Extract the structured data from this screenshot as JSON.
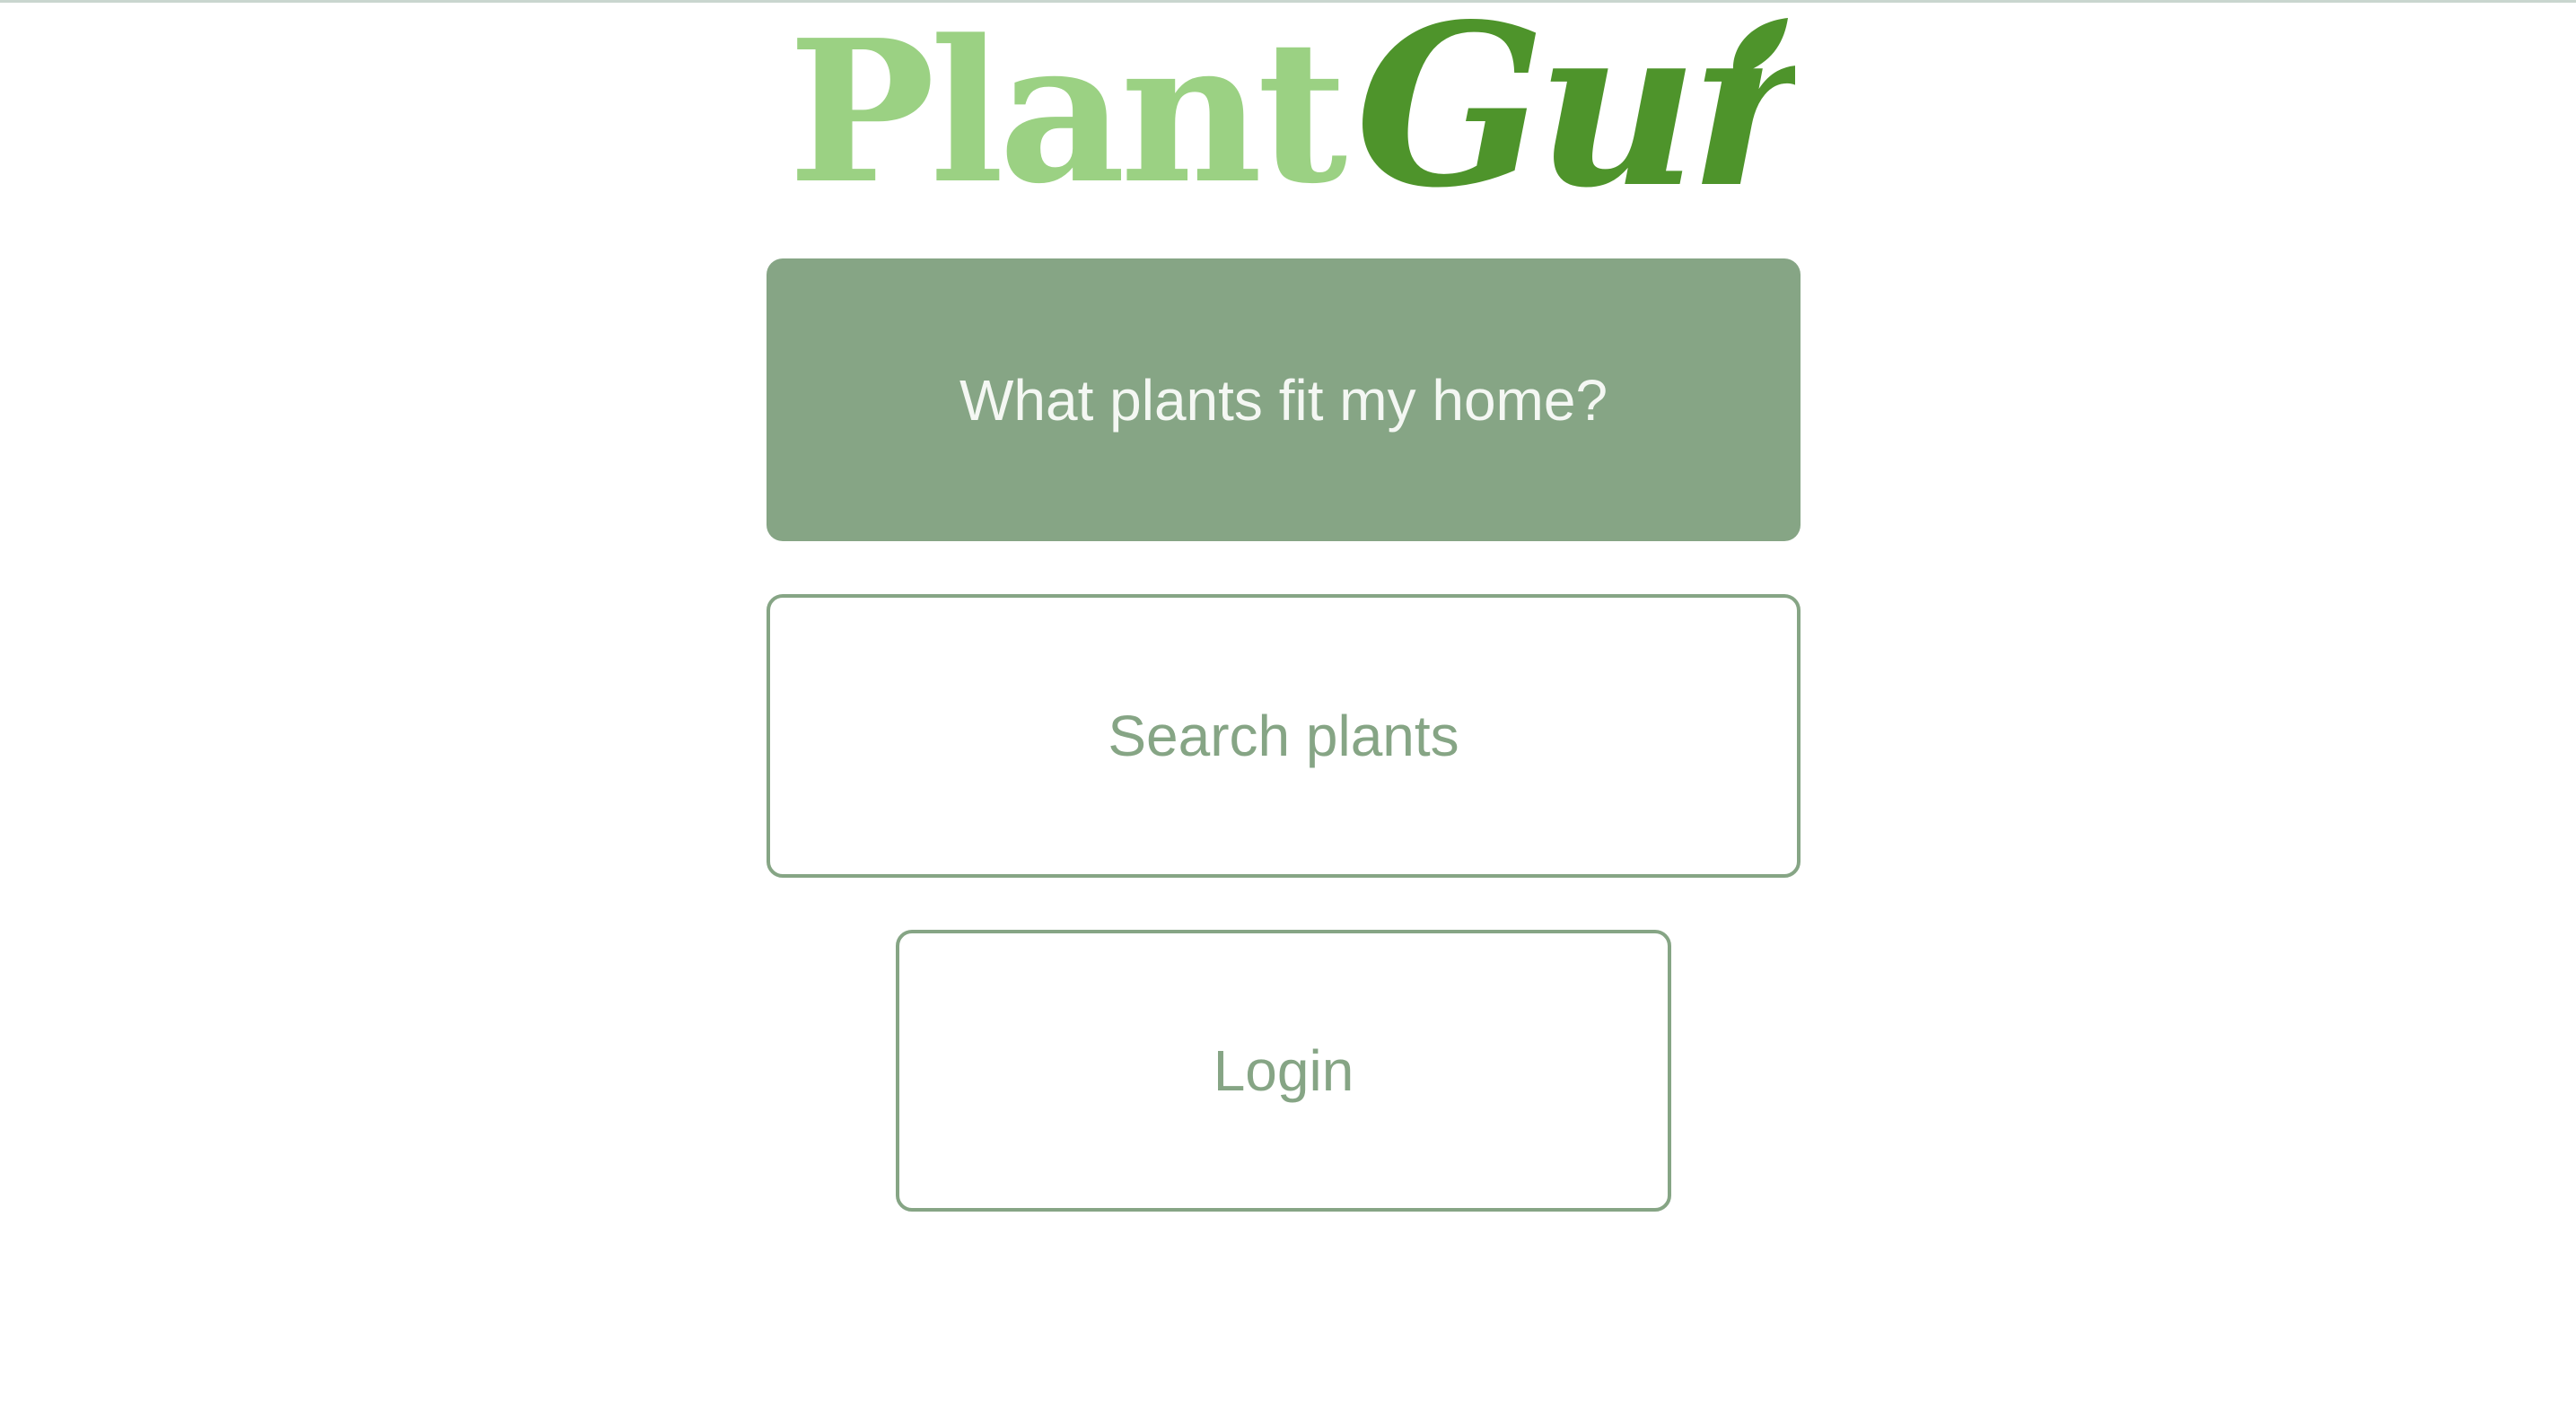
{
  "logo": {
    "part1": "Plant",
    "part2": "Guru",
    "colors": {
      "plant": "#9bd183",
      "guru": "#4e942b"
    },
    "icon": "leaf-icon"
  },
  "actions": {
    "fit_home_label": "What plants fit my home?",
    "search_label": "Search plants",
    "login_label": "Login"
  },
  "theme": {
    "primary": "#86a585",
    "primary_text": "#f4f7f3",
    "background": "#ffffff"
  }
}
